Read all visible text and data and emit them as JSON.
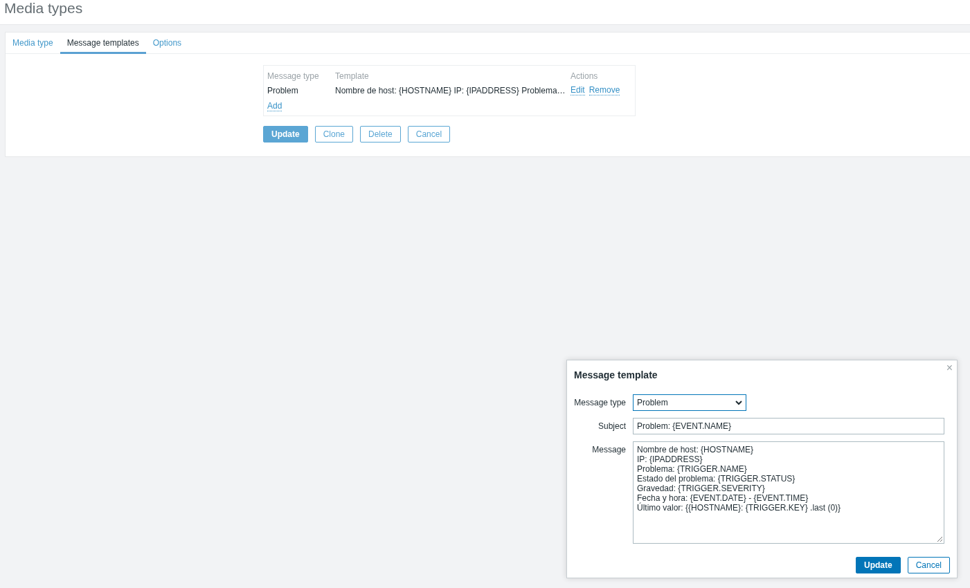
{
  "page_title": "Media types",
  "tabs": [
    {
      "label": "Media type",
      "selected": false
    },
    {
      "label": "Message templates",
      "selected": true
    },
    {
      "label": "Options",
      "selected": false
    }
  ],
  "table": {
    "columns": [
      "Message type",
      "Template",
      "Actions"
    ],
    "rows": [
      {
        "message_type": "Problem",
        "template": "Nombre de host: {HOSTNAME} IP: {IPADDRESS} Problema…",
        "actions": [
          "Edit",
          "Remove"
        ]
      }
    ],
    "add_link": "Add"
  },
  "form_buttons": [
    {
      "label": "Update",
      "kind": "primary"
    },
    {
      "label": "Clone",
      "kind": "secondary"
    },
    {
      "label": "Delete",
      "kind": "secondary"
    },
    {
      "label": "Cancel",
      "kind": "secondary"
    }
  ],
  "dialog": {
    "title": "Message template",
    "close": "×",
    "message_type_label": "Message type",
    "message_type_value": "Problem",
    "subject_label": "Subject",
    "subject_value": "Problem: {EVENT.NAME}",
    "message_label": "Message",
    "message_value": "Nombre de host: {HOSTNAME}\nIP: {IPADDRESS}\nProblema: {TRIGGER.NAME}\nEstado del problema: {TRIGGER.STATUS}\nGravedad: {TRIGGER.SEVERITY}\nFecha y hora: {EVENT.DATE} - {EVENT.TIME}\nÚltimo valor: {{HOSTNAME}: {TRIGGER.KEY} .last (0)}",
    "buttons": [
      {
        "label": "Update",
        "kind": "primary"
      },
      {
        "label": "Cancel",
        "kind": "secondary"
      }
    ]
  }
}
